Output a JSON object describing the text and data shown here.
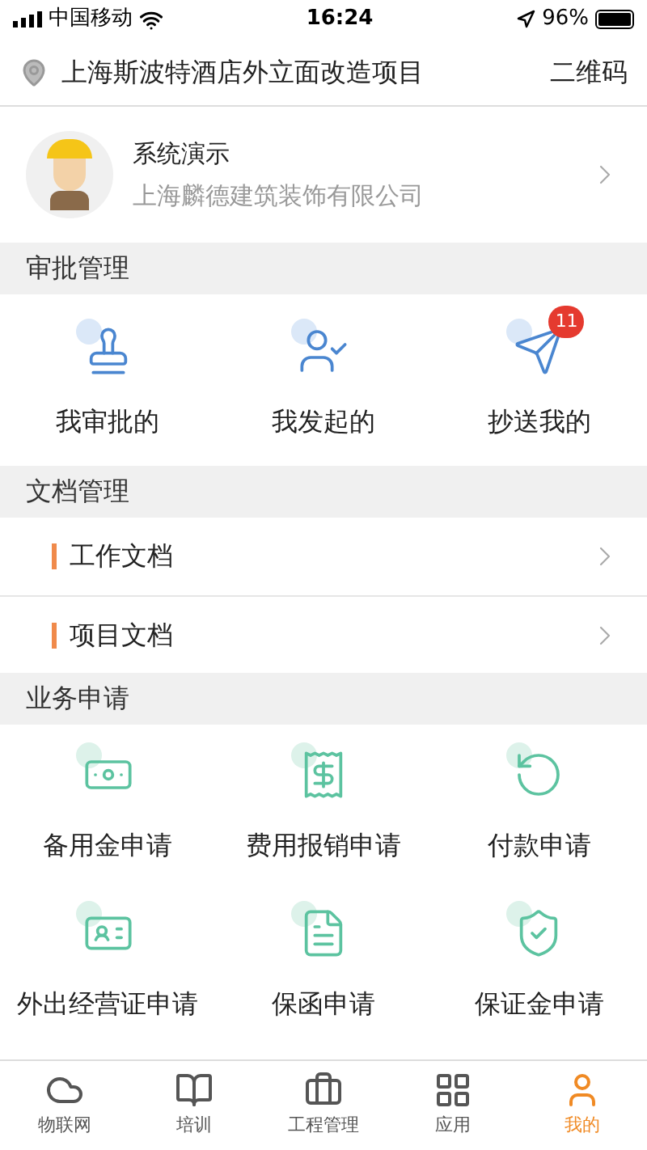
{
  "status_bar": {
    "carrier": "中国移动",
    "time": "16:24",
    "battery": "96%"
  },
  "header": {
    "project": "上海斯波特酒店外立面改造项目",
    "qr_button": "二维码"
  },
  "profile": {
    "name": "系统演示",
    "company": "上海麟德建筑装饰有限公司"
  },
  "sections": [
    {
      "title": "审批管理",
      "kind": "grid",
      "items": [
        {
          "label": "我审批的"
        },
        {
          "label": "我发起的"
        },
        {
          "label": "抄送我的",
          "badge": "11"
        }
      ]
    },
    {
      "title": "文档管理",
      "kind": "list",
      "items": [
        {
          "label": "工作文档"
        },
        {
          "label": "项目文档"
        }
      ]
    },
    {
      "title": "业务申请",
      "kind": "grid",
      "items": [
        {
          "label": "备用金申请"
        },
        {
          "label": "费用报销申请"
        },
        {
          "label": "付款申请"
        },
        {
          "label": "外出经营证申请"
        },
        {
          "label": "保函申请"
        },
        {
          "label": "保证金申请"
        }
      ]
    }
  ],
  "tabs": [
    {
      "label": "物联网",
      "selected": false
    },
    {
      "label": "培训",
      "selected": false
    },
    {
      "label": "工程管理",
      "selected": false
    },
    {
      "label": "应用",
      "selected": false
    },
    {
      "label": "我的",
      "selected": true
    }
  ]
}
